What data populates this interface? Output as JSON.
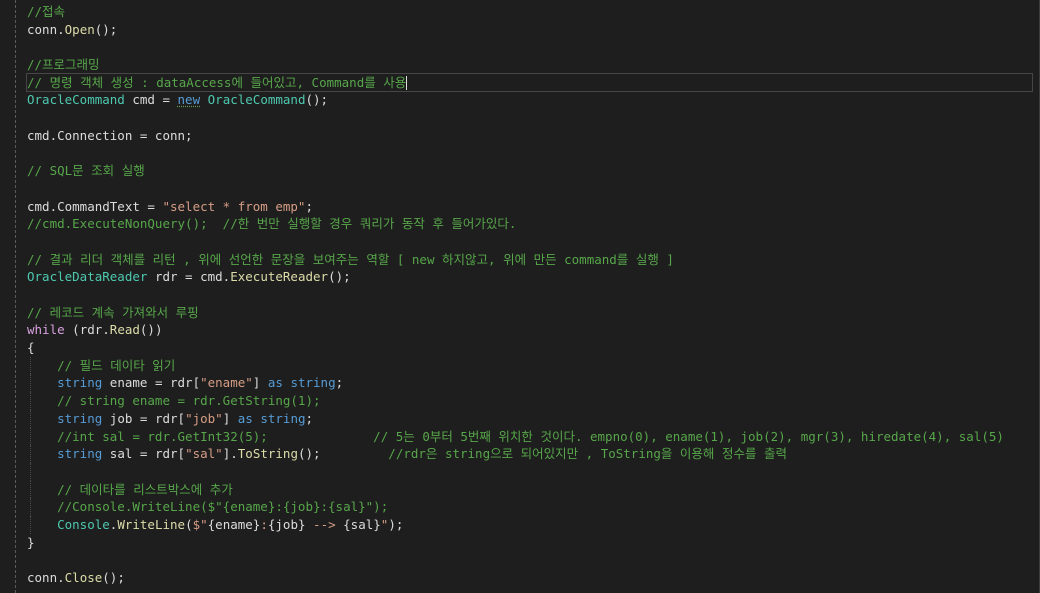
{
  "colors": {
    "background": "#1e1e1e",
    "comment": "#57a64a",
    "keyword": "#569cd6",
    "type": "#4ec9b0",
    "string": "#d69d85",
    "method": "#dcdcaa",
    "variable": "#9cdcfe",
    "plain": "#dcdcdc",
    "control": "#d8a0df"
  },
  "lines": {
    "l1": "//접속",
    "l2a": "conn.",
    "l2b": "Open",
    "l2c": "();",
    "l4": "//프로그래밍",
    "l5": "// 명령 객체 생성 : dataAccess에 들어있고, Command를 사용",
    "l6a": "OracleCommand",
    "l6b": " cmd = ",
    "l6c": "new",
    "l6d": " ",
    "l6e": "OracleCommand",
    "l6f": "();",
    "l8a": "cmd.Connection = conn;",
    "l10": "// SQL문 조회 실행",
    "l12a": "cmd.CommandText = ",
    "l12b": "\"select * from emp\"",
    "l12c": ";",
    "l13": "//cmd.ExecuteNonQuery();  //한 번만 실행할 경우 쿼리가 동작 후 들어가있다.",
    "l15": "// 결과 리더 객체를 리턴 , 위에 선언한 문장을 보여주는 역할 [ new 하지않고, 위에 만든 command를 실행 ]",
    "l16a": "OracleDataReader",
    "l16b": " rdr = cmd.",
    "l16c": "ExecuteReader",
    "l16d": "();",
    "l18": "// 레코드 계속 가져와서 루핑",
    "l19a": "while",
    "l19b": " (rdr.",
    "l19c": "Read",
    "l19d": "())",
    "l20": "{",
    "l21": "    // 필드 데이타 읽기",
    "l22a": "    ",
    "l22b": "string",
    "l22c": " ename = rdr[",
    "l22d": "\"ename\"",
    "l22e": "] ",
    "l22f": "as",
    "l22g": " ",
    "l22h": "string",
    "l22i": ";",
    "l23": "    // string ename = rdr.GetString(1);",
    "l24a": "    ",
    "l24b": "string",
    "l24c": " job = rdr[",
    "l24d": "\"job\"",
    "l24e": "] ",
    "l24f": "as",
    "l24g": " ",
    "l24h": "string",
    "l24i": ";",
    "l25a": "    //int sal = rdr.GetInt32(5);",
    "l25b": "              // 5는 0부터 5번째 위치한 것이다. empno(0), ename(1), job(2), mgr(3), hiredate(4), sal(5)",
    "l26a": "    ",
    "l26b": "string",
    "l26c": " sal = rdr[",
    "l26d": "\"sal\"",
    "l26e": "].",
    "l26f": "ToString",
    "l26g": "();",
    "l26h": "         //rdr은 string으로 되어있지만 , ToString을 이용해 정수를 출력",
    "l28": "    // 데이타를 리스트박스에 추가",
    "l29": "    //Console.WriteLine($\"{ename}:{job}:{sal}\");",
    "l30a": "    ",
    "l30b": "Console",
    "l30c": ".",
    "l30d": "WriteLine",
    "l30e": "(",
    "l30f": "$\"",
    "l30g": "{ename}",
    "l30h": ":",
    "l30i": "{job}",
    "l30j": " --> ",
    "l30k": "{sal}",
    "l30l": "\"",
    "l30m": ");",
    "l31": "}",
    "l33a": "conn.",
    "l33b": "Close",
    "l33c": "();"
  }
}
